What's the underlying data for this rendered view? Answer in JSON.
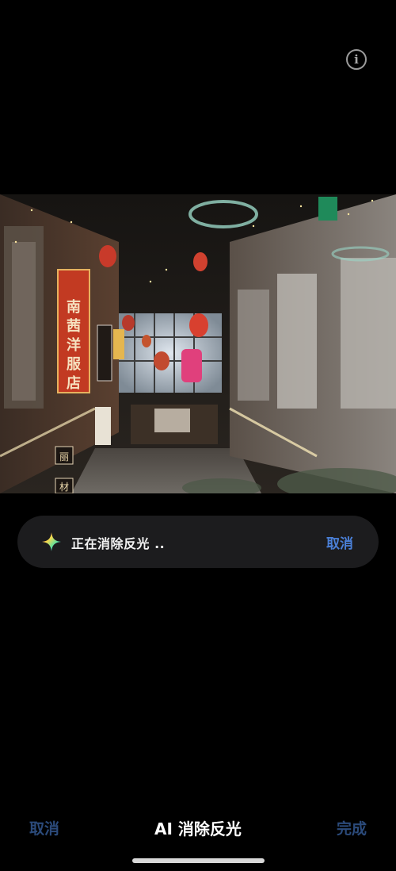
{
  "header": {
    "info_icon": "info-circle-icon",
    "info_glyph": "i"
  },
  "photo": {
    "description_icon": "photo",
    "signs": {
      "main_sign": [
        "南",
        "茜",
        "洋",
        "服",
        "店"
      ],
      "small_sign_1": "丽",
      "small_sign_2": "材"
    }
  },
  "status": {
    "icon": "sparkle-icon",
    "text": "正在消除反光 ..",
    "cancel_label": "取消"
  },
  "bottom_bar": {
    "cancel_label": "取消",
    "title": "AI 消除反光",
    "done_label": "完成"
  },
  "colors": {
    "accent": "#4a7fd6",
    "disabled_accent": "#2b4a7a",
    "pill_bg": "#1c1c1e",
    "background": "#000000"
  }
}
